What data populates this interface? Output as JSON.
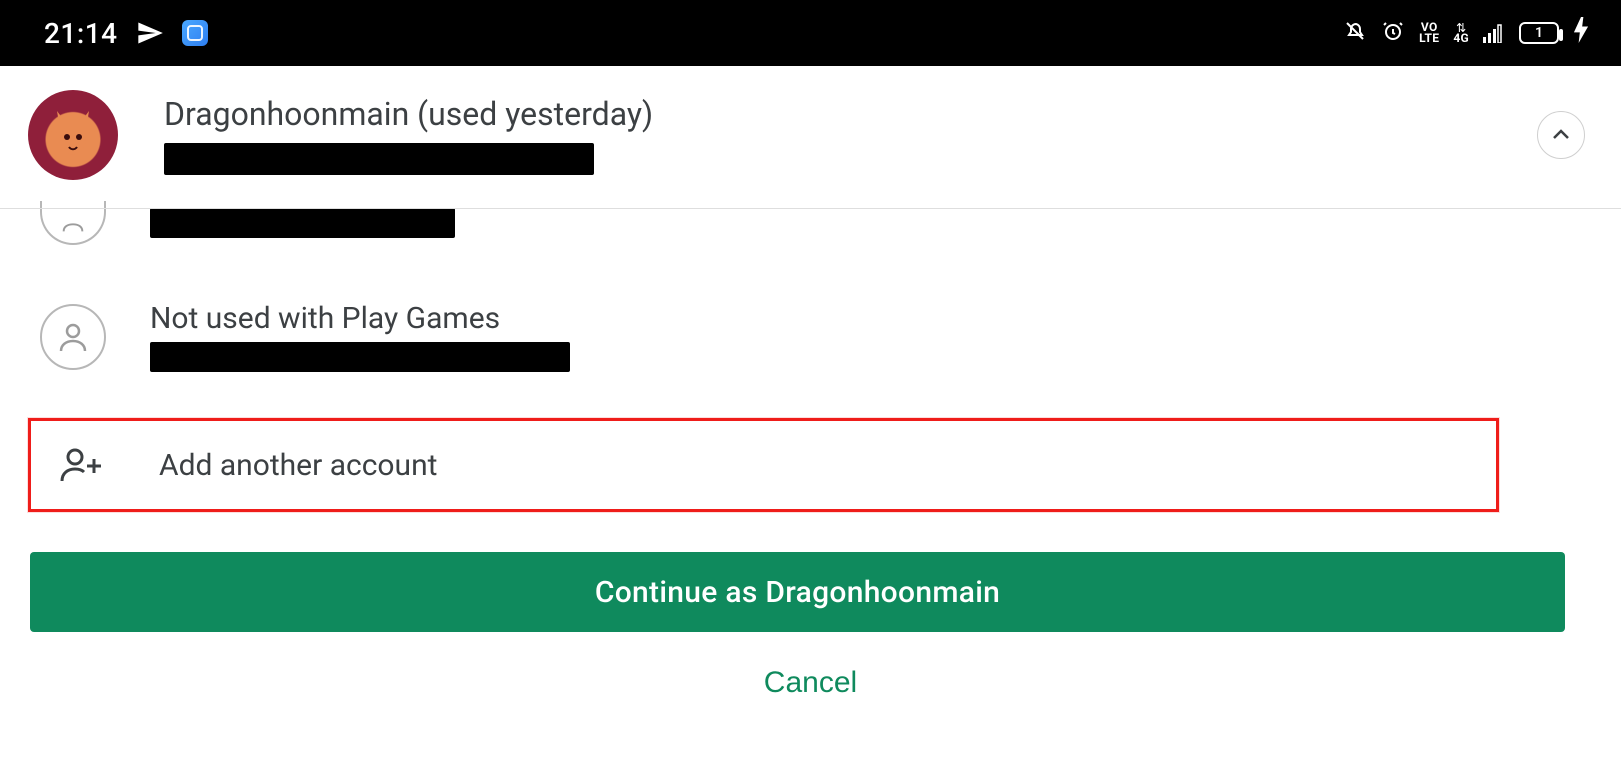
{
  "status": {
    "time": "21:14",
    "volte_top": "VO",
    "volte_bot": "LTE",
    "net_label": "4G",
    "battery_text": "1"
  },
  "header": {
    "title": "Dragonhoonmain (used yesterday)"
  },
  "accounts": {
    "second_title": "Not used with Play Games"
  },
  "add": {
    "label": "Add another account"
  },
  "buttons": {
    "continue": "Continue as Dragonhoonmain",
    "cancel": "Cancel"
  }
}
